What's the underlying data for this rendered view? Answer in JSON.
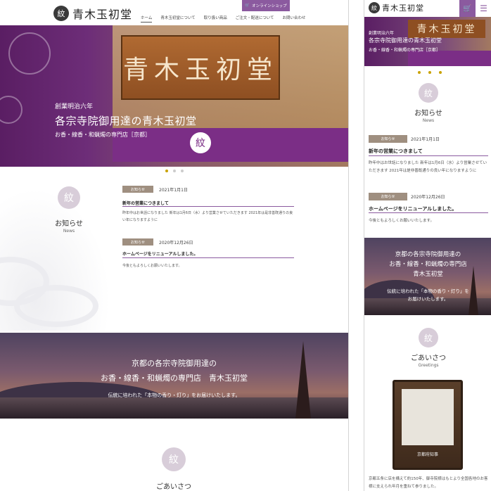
{
  "brand": {
    "name": "青木玉初堂",
    "mark": "紋"
  },
  "nav": {
    "items": [
      "ホーム",
      "青木玉初堂について",
      "取り扱い商品",
      "ご注文・配送について",
      "お問い合わせ"
    ],
    "shop_label": "オンラインショップ",
    "cart_icon": "cart-icon",
    "menu_icon": "hamburger-icon"
  },
  "hero": {
    "sign_text": "青木玉初堂",
    "founded": "創業明治六年",
    "headline": "各宗寺院御用達の青木玉初堂",
    "subline": "お香・線香・和蝋燭の専門店［京都］"
  },
  "news": {
    "title": "お知らせ",
    "subtitle": "News",
    "items": [
      {
        "tag": "お知らせ",
        "date": "2021年1月1日",
        "title": "新年の営業につきまして",
        "body": "昨年中はお世話になりました 新年は1月6日（水）より営業させていただきます 2021年は是非善既通りの良い年になりますように",
        "body_mobile": "昨年中はお世話になりました 新年は1月6日（水）より営業させていただきます 2021年は是非善既通りの良い年になりますように"
      },
      {
        "tag": "お知らせ",
        "date": "2020年12月26日",
        "title": "ホームページをリニューアルしました。",
        "body": "今後ともよろしくお願いいたします。",
        "body_mobile": "今後ともよろしくお願いいたします。"
      }
    ]
  },
  "banner": {
    "desktop_line1": "京都の各宗寺院御用達の",
    "desktop_line2": "お香・線香・和蝋燭の専門店　青木玉初堂",
    "tagline": "伝統に培われた「本物の香り・灯り」をお届けいたします。",
    "mobile_line1": "京都の各宗寺院御用達の",
    "mobile_line2": "お香・線香・和蝋燭の専門店",
    "mobile_line3": "青木玉初堂",
    "mobile_tagline1": "伝統に培われた「本物の香り・灯り」を",
    "mobile_tagline2": "お届けいたします。"
  },
  "greeting": {
    "title": "ごあいさつ",
    "subtitle": "Greetings",
    "plaque_label": "京都府知事",
    "body": "京都五条に店を構えて約150年、御寺院様はもとより全国各地のお客様に支えられ年月を重ねて参りました。"
  },
  "colors": {
    "accent": "#8b5a9f",
    "tag": "#9f8f80",
    "dot_active": "#c9a200"
  }
}
